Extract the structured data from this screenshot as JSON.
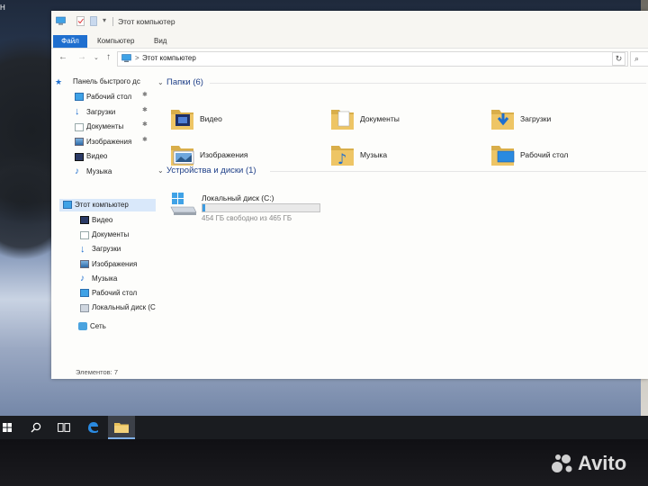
{
  "desktop": {
    "corner_text": "Н"
  },
  "window": {
    "title": "Этот компьютер",
    "ribbon_tabs": [
      "Файл",
      "Компьютер",
      "Вид"
    ],
    "address_path": "Этот компьютер",
    "address_separator": ">",
    "refresh_icon": "refresh-icon",
    "search_icon": "search-icon"
  },
  "nav_pane": {
    "quick_access": "Панель быстрого дс",
    "quick_items": [
      {
        "label": "Рабочий стол",
        "icon": "desktop-icon",
        "pinned": true
      },
      {
        "label": "Загрузки",
        "icon": "downloads-icon",
        "pinned": true
      },
      {
        "label": "Документы",
        "icon": "documents-icon",
        "pinned": true
      },
      {
        "label": "Изображения",
        "icon": "pictures-icon",
        "pinned": true
      },
      {
        "label": "Видео",
        "icon": "videos-icon",
        "pinned": false
      },
      {
        "label": "Музыка",
        "icon": "music-icon",
        "pinned": false
      }
    ],
    "this_pc": "Этот компьютер",
    "pc_items": [
      {
        "label": "Видео",
        "icon": "videos-icon"
      },
      {
        "label": "Документы",
        "icon": "documents-icon"
      },
      {
        "label": "Загрузки",
        "icon": "downloads-icon"
      },
      {
        "label": "Изображения",
        "icon": "pictures-icon"
      },
      {
        "label": "Музыка",
        "icon": "music-icon"
      },
      {
        "label": "Рабочий стол",
        "icon": "desktop-icon"
      },
      {
        "label": "Локальный диск (С",
        "icon": "drive-icon"
      }
    ],
    "network": "Сеть",
    "pin_glyph": "✱"
  },
  "content": {
    "folders_header": "Папки (6)",
    "folders": [
      {
        "label": "Видео",
        "icon": "videos-folder-icon"
      },
      {
        "label": "Документы",
        "icon": "documents-folder-icon"
      },
      {
        "label": "Загрузки",
        "icon": "downloads-folder-icon"
      },
      {
        "label": "Изображения",
        "icon": "pictures-folder-icon"
      },
      {
        "label": "Музыка",
        "icon": "music-folder-icon"
      },
      {
        "label": "Рабочий стол",
        "icon": "desktop-folder-icon"
      }
    ],
    "devices_header": "Устройства и диски (1)",
    "drive": {
      "name": "Локальный диск (C:)",
      "free_text": "454 ГБ свободно из 465 ГБ",
      "used_fraction": 0.024
    }
  },
  "status": {
    "items_text": "Элементов: 7"
  },
  "colors": {
    "accent": "#1f6fcf",
    "header_blue": "#1e3f88",
    "folder_yellow": "#e9c15a",
    "drive_bar": "#3c9be0"
  },
  "watermark": {
    "text": "Avito"
  }
}
